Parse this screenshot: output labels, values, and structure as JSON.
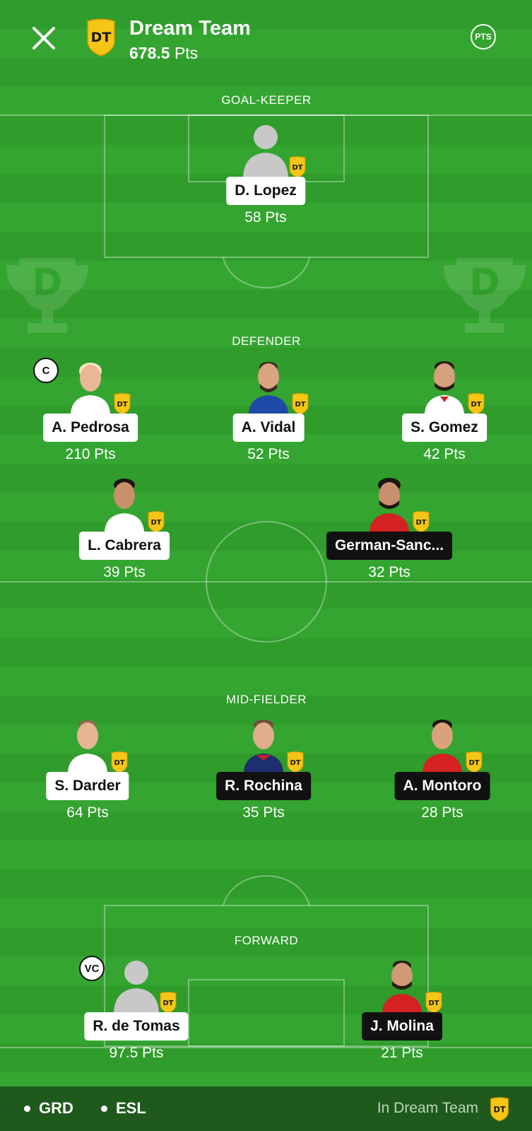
{
  "header": {
    "title": "Dream Team",
    "points_value": "678.5",
    "points_unit": "Pts",
    "badge_text": "DT",
    "pts_button": "PTS"
  },
  "sections": {
    "goalkeeper": "GOAL-KEEPER",
    "defender": "DEFENDER",
    "midfielder": "MID-FIELDER",
    "forward": "FORWARD"
  },
  "players": {
    "gk1": {
      "name": "D. Lopez",
      "pts": "58 Pts"
    },
    "def1": {
      "name": "A. Pedrosa",
      "pts": "210 Pts",
      "role": "C"
    },
    "def2": {
      "name": "A. Vidal",
      "pts": "52 Pts"
    },
    "def3": {
      "name": "S. Gomez",
      "pts": "42 Pts"
    },
    "def4": {
      "name": "L. Cabrera",
      "pts": "39 Pts"
    },
    "def5": {
      "name": "German-Sanc...",
      "pts": "32 Pts"
    },
    "mid1": {
      "name": "S. Darder",
      "pts": "64 Pts"
    },
    "mid2": {
      "name": "R. Rochina",
      "pts": "35 Pts"
    },
    "mid3": {
      "name": "A. Montoro",
      "pts": "28 Pts"
    },
    "fwd1": {
      "name": "R. de Tomas",
      "pts": "97.5 Pts",
      "role": "VC"
    },
    "fwd2": {
      "name": "J. Molina",
      "pts": "21 Pts"
    }
  },
  "footer": {
    "team_a": "GRD",
    "team_b": "ESL",
    "note": "In Dream Team"
  },
  "colors": {
    "badge_yellow": "#f5c518",
    "pitch_green": "#2f9c2b",
    "footer_green": "#1f5a1c"
  }
}
